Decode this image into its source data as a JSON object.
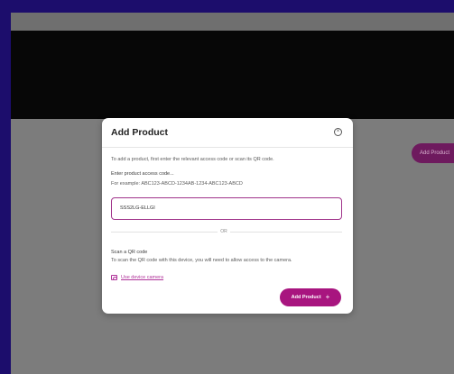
{
  "background": {
    "add_button_label": "Add Product"
  },
  "modal": {
    "title": "Add Product",
    "intro": "To add a product, first enter the relevant access code or scan its QR code.",
    "access_code": {
      "label": "Enter product access code...",
      "example": "For example: ABC123-ABCD-1234AB-1234-ABC123-ABCD",
      "value": "SSS2LG-ELLGI"
    },
    "separator": "OR",
    "qr": {
      "heading": "Scan a QR code",
      "description": "To scan the QR code with this device, you will need to allow access to the camera.",
      "camera_link": "Use device camera"
    },
    "submit_label": "Add Product",
    "icons": {
      "close": "close-circle-icon",
      "camera": "camera-icon",
      "plus": "plus-icon"
    }
  },
  "colors": {
    "accent": "#a8157f",
    "link": "#b0339a",
    "page_bg": "#1c0d6c"
  }
}
